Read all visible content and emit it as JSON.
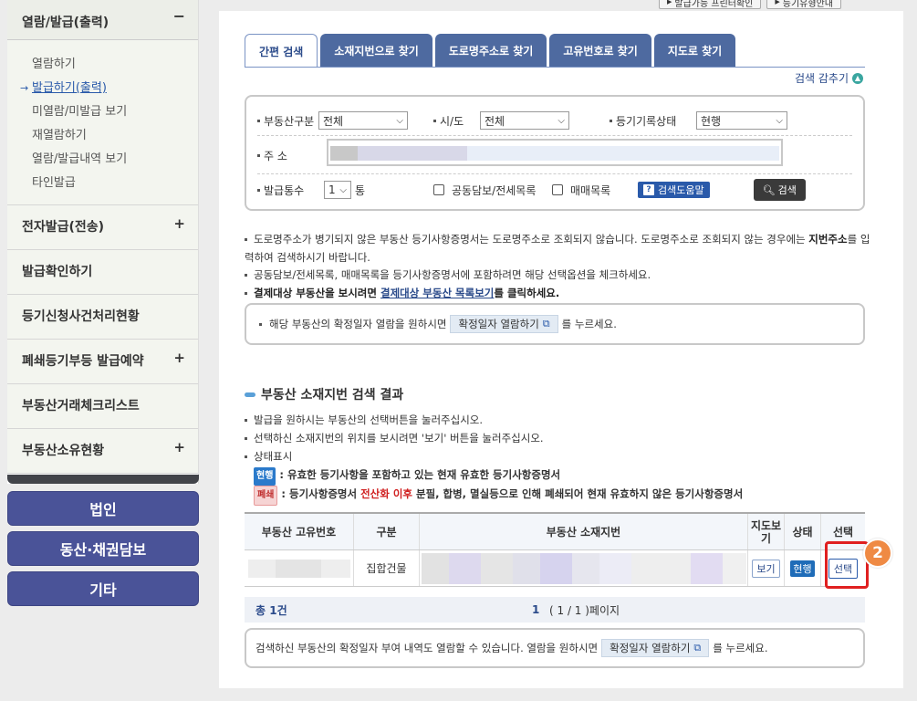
{
  "top_buttons": [
    "발급가능 프린터확인",
    "등기유형안내"
  ],
  "sidebar": {
    "header": "열람/발급(출력)",
    "header_sign": "−",
    "sub_items": [
      {
        "label": "열람하기"
      },
      {
        "label": "발급하기(출력)",
        "pointer": "→"
      },
      {
        "label": "미열람/미발급 보기"
      },
      {
        "label": "재열람하기"
      },
      {
        "label": "열람/발급내역 보기"
      },
      {
        "label": "타인발급"
      }
    ],
    "menus": [
      {
        "label": "전자발급(전송)",
        "sign": "+"
      },
      {
        "label": "발급확인하기",
        "sign": ""
      },
      {
        "label": "등기신청사건처리현황",
        "sign": ""
      },
      {
        "label": "폐쇄등기부등 발급예약",
        "sign": "+"
      },
      {
        "label": "부동산거래체크리스트",
        "sign": ""
      },
      {
        "label": "부동산소유현황",
        "sign": "+"
      }
    ],
    "big_buttons": [
      "법인",
      "동산·채권담보",
      "기타"
    ]
  },
  "tabs": [
    "간편 검색",
    "소재지번으로 찾기",
    "도로명주소로 찾기",
    "고유번호로 찾기",
    "지도로 찾기"
  ],
  "collapse_label": "검색 감추기",
  "search": {
    "type_label": "부동산구분",
    "type_value": "전체",
    "city_label": "시/도",
    "city_value": "전체",
    "status_label": "등기기록상태",
    "status_value": "현행",
    "address_label": "주 소",
    "count_label": "발급통수",
    "count_value": "1",
    "count_unit": "통",
    "chk1_label": "공동담보/전세목록",
    "chk2_label": "매매목록",
    "help_label": "검색도움말",
    "search_label": "검색"
  },
  "notices": {
    "n1a": "도로명주소가 병기되지 않은 부동산 등기사항증명서는 도로명주소로 조회되지 않습니다. 도로명주소로 조회되지 않는 경우에는 ",
    "n1b": "지번주소",
    "n1c": "를 입력하여 검색하시기 바랍니다.",
    "n2": "공동담보/전세목록, 매매목록을 등기사항증명서에 포함하려면 해당 선택옵션을 체크하세요.",
    "n3a": "결제대상 부동산을 보시려면 ",
    "n3b": "결제대상 부동산 목록보기",
    "n3c": "를 클릭하세요."
  },
  "info1": {
    "pre": "해당 부동산의 확정일자 열람을 원하시면",
    "btn": "확정일자 열람하기",
    "post": "를 누르세요."
  },
  "result": {
    "title": "부동산 소재지번 검색 결과",
    "g1": "발급을 원하시는 부동산의 선택버튼을 눌러주십시오.",
    "g2": "선택하신 소재지번의 위치를 보시려면 '보기' 버튼을 눌러주십시오.",
    "g3": "상태표시",
    "s1_badge": "현행",
    "s1_text": ": 유효한 등기사항을 포함하고 있는 현재 유효한 등기사항증명서",
    "s2_badge": "폐쇄",
    "s2_text_a": ": 등기사항증명서 ",
    "s2_text_b": "전산화 이후",
    "s2_text_c": " 분필, 합병, 멸실등으로 인해 폐쇄되어 현재 유효하지 않은 등기사항증명서"
  },
  "table": {
    "headers": [
      "부동산 고유번호",
      "구분",
      "부동산 소재지번",
      "지도보기",
      "상태",
      "선택"
    ],
    "row": {
      "kind": "집합건물",
      "map": "보기",
      "status": "현행",
      "select": "선택"
    }
  },
  "step_number": "2",
  "pager": {
    "total": "총 1건",
    "page": "1",
    "page_info": "( 1 / 1 )페이지"
  },
  "info2": {
    "pre": "검색하신 부동산의 확정일자 부여 내역도 열람할 수 있습니다. 열람을 원하시면",
    "btn": "확정일자 열람하기",
    "post": "를 누르세요."
  }
}
